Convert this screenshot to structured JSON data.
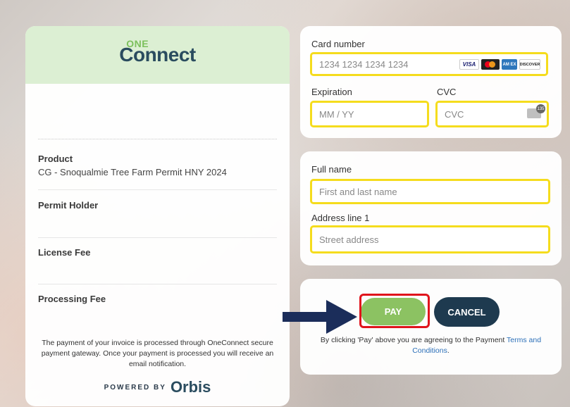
{
  "brand": {
    "logo_one": "ONE",
    "logo_connect": "Connect",
    "powered_by": "POWERED BY",
    "orbis": "Orbis"
  },
  "summary": {
    "product_label": "Product",
    "product_value": "CG - Snoqualmie Tree Farm Permit HNY 2024",
    "permit_holder_label": "Permit Holder",
    "license_fee_label": "License Fee",
    "processing_fee_label": "Processing Fee",
    "footer_note": "The payment of your invoice is processed through OneConnect secure payment gateway. Once your payment is processed you will receive an email notification."
  },
  "card": {
    "card_number_label": "Card number",
    "card_number_placeholder": "1234 1234 1234 1234",
    "expiration_label": "Expiration",
    "expiration_placeholder": "MM / YY",
    "cvc_label": "CVC",
    "cvc_placeholder": "CVC",
    "cvc_icon_text": "135",
    "brands": [
      "VISA",
      "MC",
      "AM EX",
      "DISCOVER"
    ]
  },
  "address": {
    "full_name_label": "Full name",
    "full_name_placeholder": "First and last name",
    "address_line1_label": "Address line 1",
    "address_line1_placeholder": "Street address"
  },
  "actions": {
    "pay_label": "PAY",
    "cancel_label": "CANCEL",
    "terms_prefix": "By clicking 'Pay' above you are agreeing to the Payment ",
    "terms_link": "Terms and Conditions",
    "terms_suffix": "."
  },
  "colors": {
    "highlight_yellow": "#f5dc1d",
    "highlight_red": "#e0141c",
    "pay_green": "#8cc262",
    "cancel_navy": "#1e3a4f",
    "arrow_navy": "#1b2d5a"
  }
}
